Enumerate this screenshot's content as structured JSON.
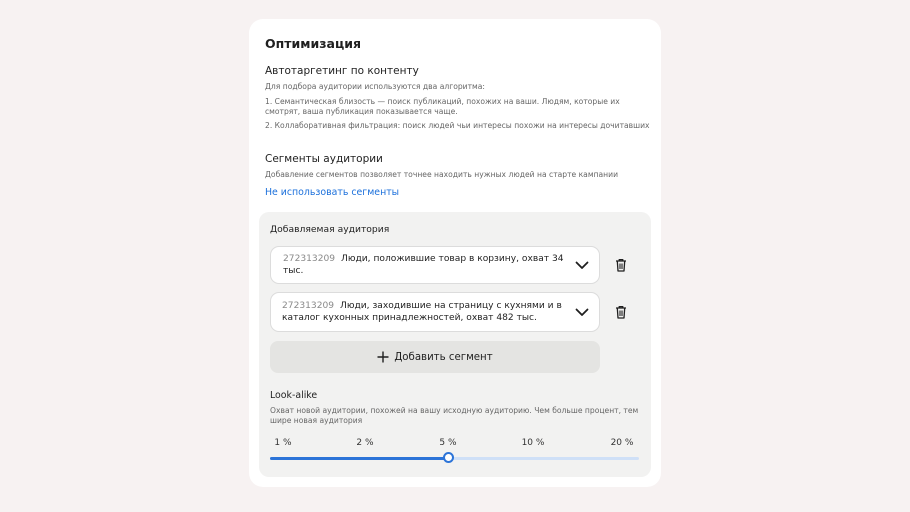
{
  "title": "Оптимизация",
  "autotargeting": {
    "heading": "Автотаргетинг по контенту",
    "intro": "Для подбора аудитории используются два алгоритма:",
    "item1": "1. Семантическая близость — поиск публикаций, похожих на ваши. Людям, которые их смотрят, ваша публикация показывается чаще.",
    "item2": "2. Коллаборативная фильтрация: поиск людей чьи интересы похожи на интересы дочитавших"
  },
  "segments": {
    "heading": "Сегменты аудитории",
    "description": "Добавление сегментов позволяет точнее находить нужных людей на старте кампании",
    "link": "Не использовать сегменты"
  },
  "audience": {
    "label": "Добавляемая аудитория",
    "items": [
      {
        "id": "272313209",
        "text": "Люди, положившие товар в корзину, охват 34 тыс."
      },
      {
        "id": "272313209",
        "text": "Люди, заходившие на страницу с кухнями и в каталог кухонных принадлежностей, охват 482 тыс."
      }
    ],
    "add_button": "Добавить сегмент"
  },
  "lookalike": {
    "heading": "Look-alike",
    "description": "Охват новой аудитории, похожей на вашу исходную аудиторию. Чем больше процент, тем шире новая аудитория",
    "ticks": [
      "1 %",
      "2 %",
      "5 %",
      "10 %",
      "20 %"
    ],
    "selected_index": 2,
    "selected": "5 %"
  },
  "colors": {
    "accent": "#2c74d8",
    "link": "#1a6fdb",
    "background": "#f7f2f2"
  },
  "icons": [
    "chevron-down-icon",
    "trash-icon",
    "plus-icon"
  ]
}
